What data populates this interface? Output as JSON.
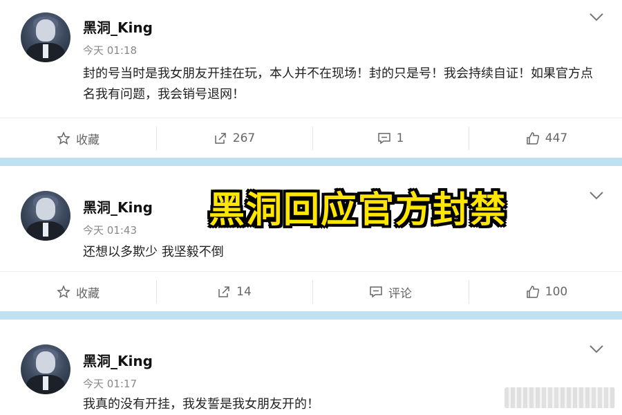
{
  "posts": [
    {
      "username": "黑洞_King",
      "time": "今天 01:18",
      "content": "封的号当时是我女朋友开挂在玩，本人并不在现场！封的只是号！我会持续自证！如果官方点名我有问题，我会销号退网！",
      "actions": {
        "favorite": "收藏",
        "repost": "267",
        "comment": "1",
        "like": "447"
      }
    },
    {
      "username": "黑洞_King",
      "time": "今天 01:43",
      "content": "还想以多欺少 我坚毅不倒",
      "actions": {
        "favorite": "收藏",
        "repost": "14",
        "comment": "评论",
        "like": "100"
      }
    },
    {
      "username": "黑洞_King",
      "time": "今天 01:17",
      "content": "我真的没有开挂，我发誓是我女朋友开的！"
    }
  ],
  "banner": "黑洞回应官方封禁",
  "icons": {
    "menu": "chevron-down-icon",
    "favorite": "star-icon",
    "repost": "share-icon",
    "comment": "comment-icon",
    "like": "thumbs-up-icon"
  },
  "colors": {
    "separator": "#bfe0f0",
    "banner_fill": "#ffe600",
    "banner_stroke": "#000000"
  }
}
